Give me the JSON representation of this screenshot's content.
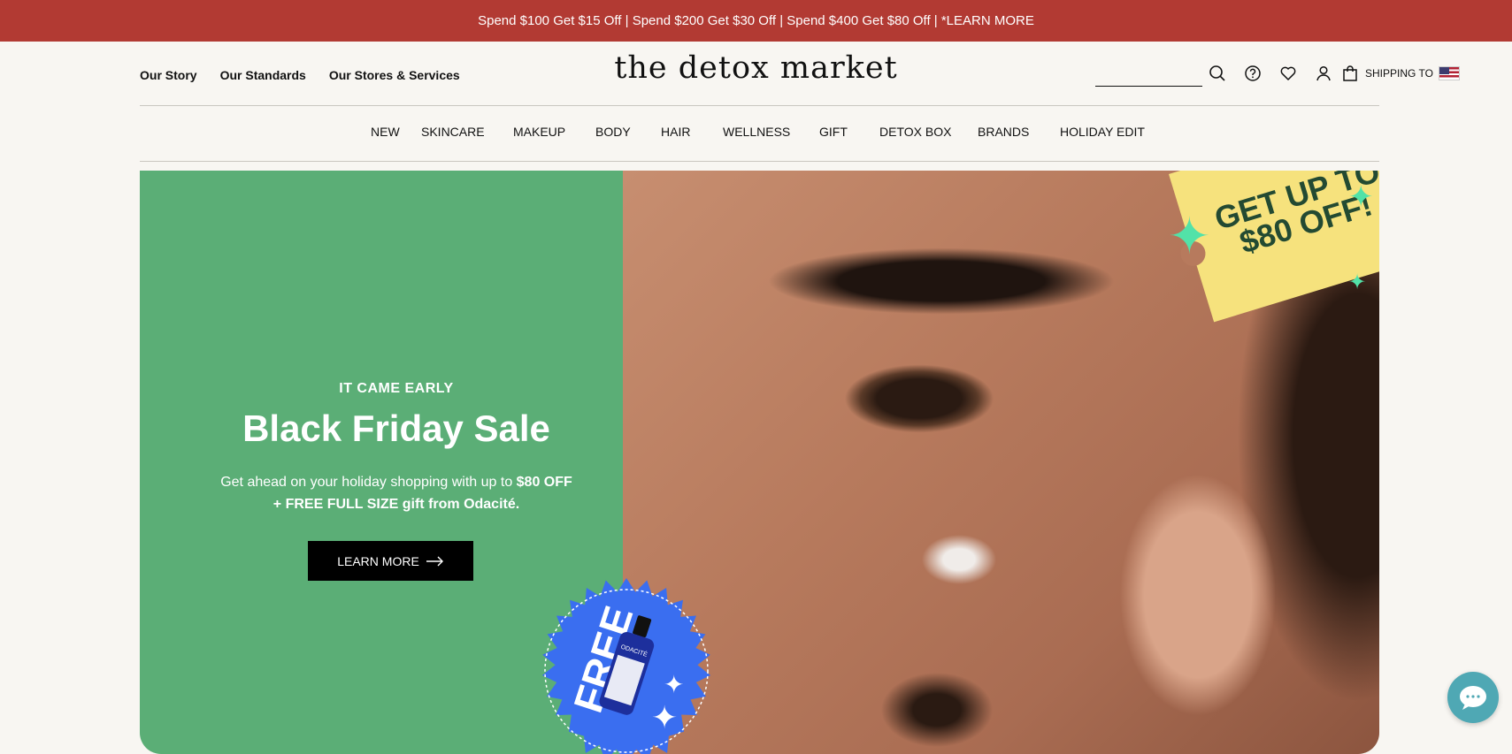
{
  "promo_bar": {
    "text": "Spend $100 Get $15 Off | Spend $200 Get $30 Off | Spend $400 Get $80 Off | *LEARN MORE"
  },
  "header": {
    "left_links": [
      "Our Story",
      "Our Standards",
      "Our Stores & Services"
    ],
    "logo": "the detox market",
    "search": {
      "placeholder": "",
      "value": ""
    },
    "shipping_label": "SHIPPING TO",
    "icons": [
      "search-icon",
      "help-icon",
      "heart-icon",
      "account-icon",
      "bag-icon",
      "us-flag-icon"
    ]
  },
  "main_nav": {
    "items": [
      "NEW",
      "SKINCARE",
      "MAKEUP",
      "BODY",
      "HAIR",
      "WELLNESS",
      "GIFT",
      "DETOX BOX",
      "BRANDS",
      "HOLIDAY EDIT"
    ]
  },
  "hero": {
    "eyebrow": "IT CAME EARLY",
    "headline": "Black Friday Sale",
    "description_prefix": "Get ahead on your holiday shopping with up to ",
    "description_bold": "$80 OFF + FREE FULL SIZE gift from Odacité.",
    "cta_label": "LEARN MORE",
    "ticket_line1": "GET UP TO",
    "ticket_line2": "$80 OFF!",
    "badge_text": "FREE",
    "bottle_brand": "ODACITÉ",
    "colors": {
      "promo_bg": "#b23a33",
      "hero_green": "#5bae76",
      "ticket_yellow": "#f6e27d",
      "ticket_text": "#234a32",
      "badge_blue": "#3a6ef0",
      "cta_bg": "#000000",
      "chat_bg": "#4fa8b4"
    }
  }
}
